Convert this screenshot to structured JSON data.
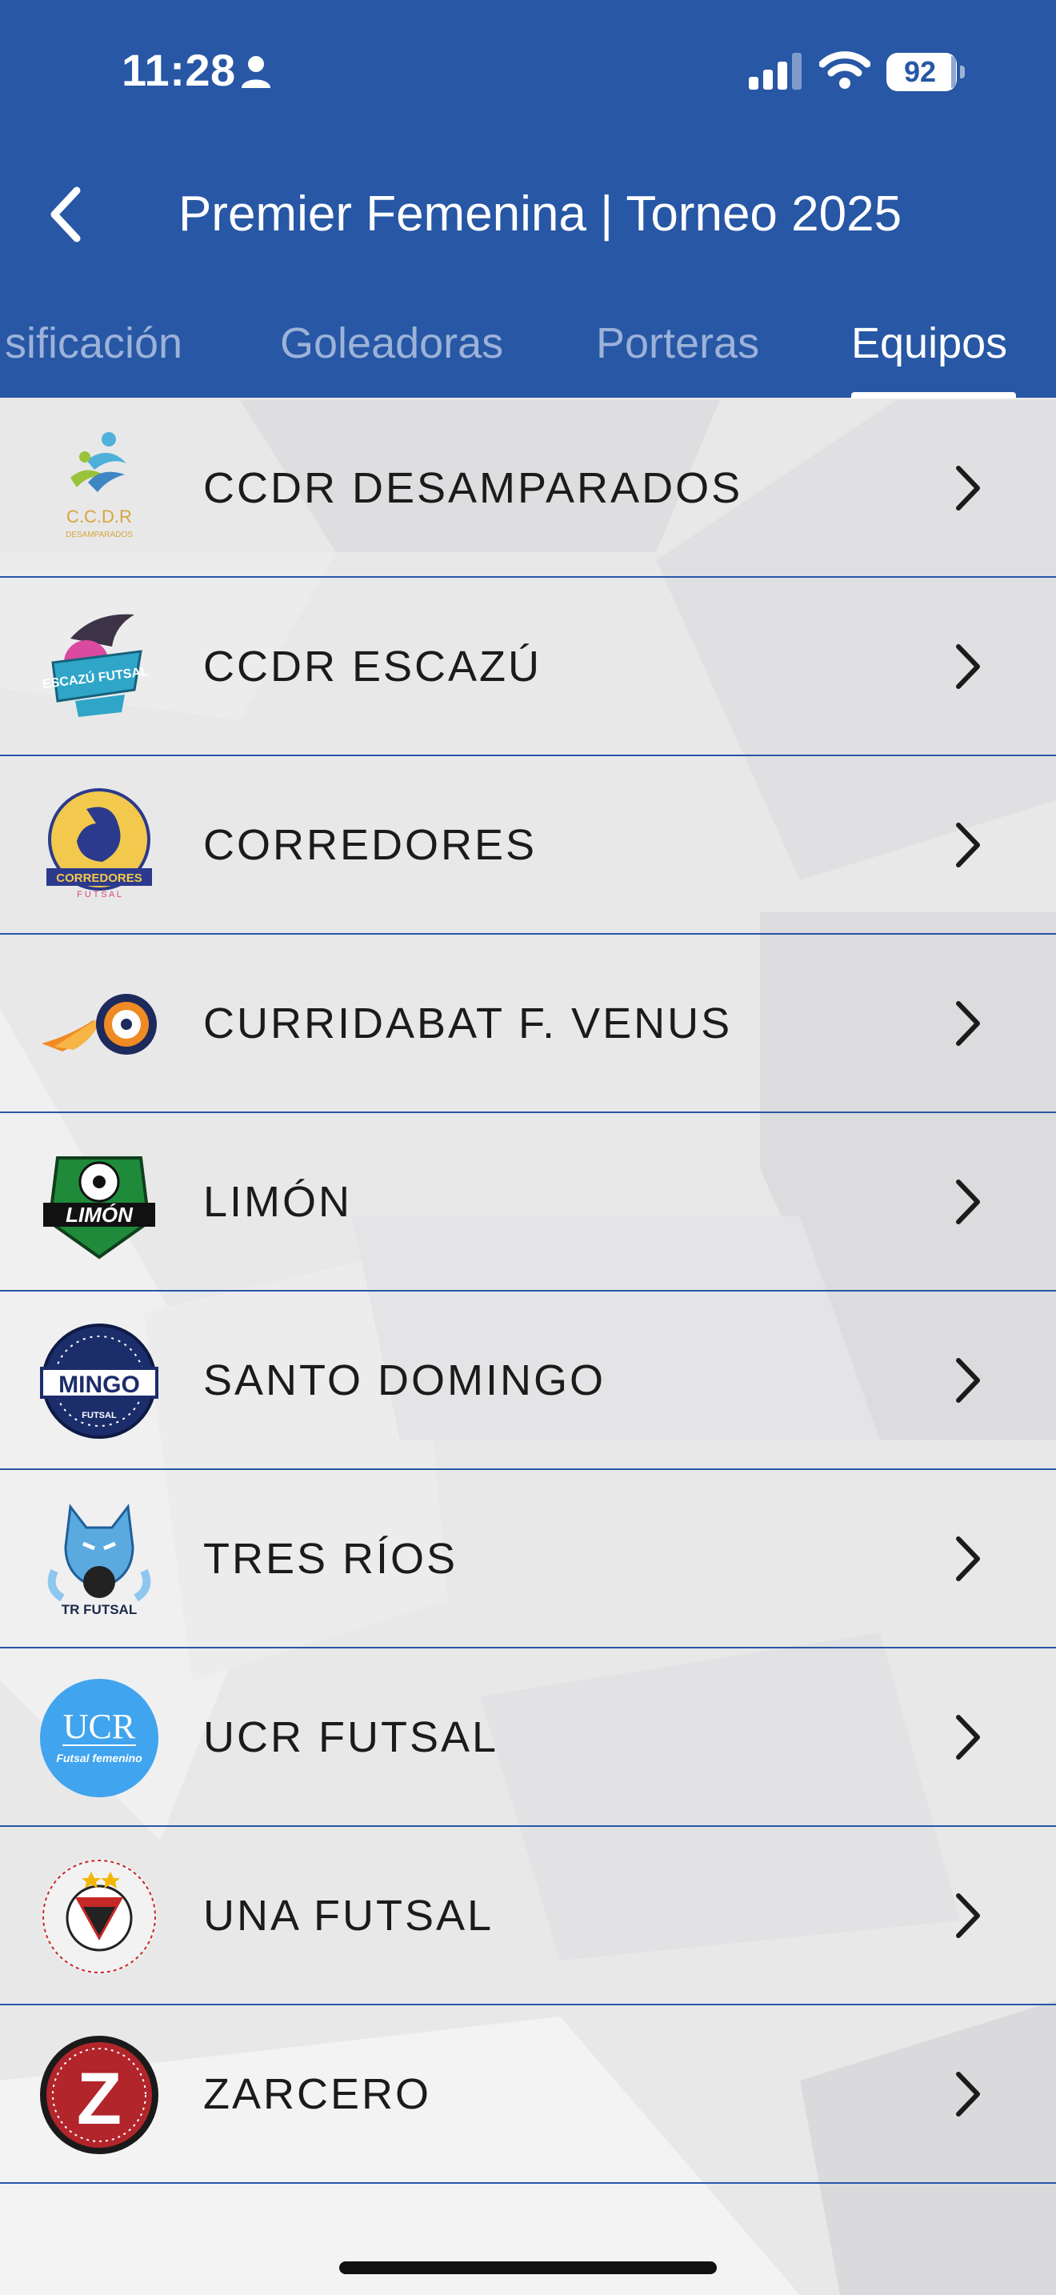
{
  "status_bar": {
    "time": "11:28",
    "battery": "92"
  },
  "nav": {
    "title": "Premier Femenina  |  Torneo 2025"
  },
  "tabs": [
    {
      "label": "sificación",
      "active": false
    },
    {
      "label": "Goleadoras",
      "active": false
    },
    {
      "label": "Porteras",
      "active": false
    },
    {
      "label": "Equipos",
      "active": true
    }
  ],
  "teams": [
    {
      "name": "CCDR DESAMPARADOS",
      "logo_icon": "ccdr-desamparados-logo",
      "logo_text": "C.C.D.R"
    },
    {
      "name": "CCDR ESCAZÚ",
      "logo_icon": "escazu-futsal-logo",
      "logo_text": "ESCAZÚ FUTSAL"
    },
    {
      "name": "CORREDORES",
      "logo_icon": "corredores-futsal-logo",
      "logo_text": "CORREDORES"
    },
    {
      "name": "CURRIDABAT F. VENUS",
      "logo_icon": "curridabat-venus-logo",
      "logo_text": ""
    },
    {
      "name": "LIMÓN",
      "logo_icon": "limon-futsal-logo",
      "logo_text": "LIMÓN"
    },
    {
      "name": "SANTO DOMINGO",
      "logo_icon": "mingo-futsal-logo",
      "logo_text": "MINGO"
    },
    {
      "name": "TRES RÍOS",
      "logo_icon": "tres-rios-futsal-logo",
      "logo_text": "TR FUTSAL"
    },
    {
      "name": "UCR FUTSAL",
      "logo_icon": "ucr-futsal-logo",
      "logo_text": "UCR"
    },
    {
      "name": "UNA FUTSAL",
      "logo_icon": "una-futsal-logo",
      "logo_text": ""
    },
    {
      "name": "ZARCERO",
      "logo_icon": "zarcero-logo",
      "logo_text": "Z"
    }
  ],
  "colors": {
    "header": "#2757a5",
    "divider": "#2757a5",
    "background": "#e9e9ea",
    "text": "#1b1b1b"
  }
}
